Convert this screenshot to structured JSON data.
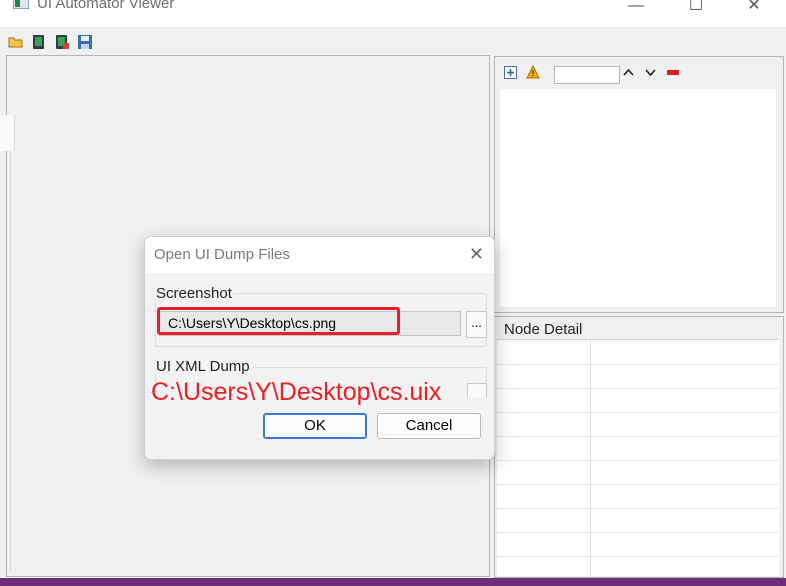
{
  "window": {
    "title": "UI Automator Viewer",
    "controls": {
      "minimize": "—",
      "maximize": "☐",
      "close": "✕"
    }
  },
  "toolbar": {
    "icons": [
      "open-folder-icon",
      "device-screenshot-icon",
      "device-screenshot-compressed-icon",
      "save-icon"
    ]
  },
  "tree_panel": {
    "tools": [
      "expand-all-icon",
      "warning-icon",
      "search-input",
      "up-arrow-icon",
      "down-arrow-icon",
      "clear-icon"
    ],
    "search_value": "",
    "up_label": "^",
    "down_label": "v"
  },
  "node_detail": {
    "title": "Node Detail"
  },
  "dialog": {
    "title": "Open UI Dump Files",
    "close": "✕",
    "screenshot_group": {
      "label": "Screenshot",
      "path": "C:\\Users\\Y\\Desktop\\cs.png",
      "browse_label": "..."
    },
    "xml_group": {
      "label": "UI XML Dump",
      "annotation": "C:\\Users\\Y\\Desktop\\cs.uix"
    },
    "ok_label": "OK",
    "cancel_label": "Cancel"
  },
  "colors": {
    "annotation": "#ee1d24",
    "highlight_box": "#e8202a",
    "ok_border": "#3a78d6",
    "desktop": "#6b2f7a"
  }
}
